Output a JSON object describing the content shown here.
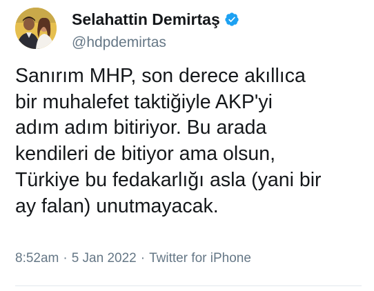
{
  "user": {
    "display_name": "Selahattin Demirtaş",
    "handle": "@hdpdemirtas",
    "verified_icon": "verified-badge-icon",
    "avatar_icon": "profile-photo"
  },
  "tweet": {
    "line_1": "Sanırım MHP, son derece akıllıca",
    "line_2": "bir muhalefet taktiğiyle AKP'yi",
    "line_3": "adım adım bitiriyor. Bu arada",
    "line_4": "kendileri de bitiyor ama olsun,",
    "line_5": "Türkiye bu fedakarlığı asla (yani bir",
    "line_6": "ay falan) unutmayacak."
  },
  "meta": {
    "time": "8:52am",
    "separator": "·",
    "date": "5 Jan 2022",
    "source": "Twitter for iPhone"
  },
  "colors": {
    "text": "#14171a",
    "secondary": "#657786",
    "verified": "#1da1f2",
    "divider": "#e1e8ed"
  }
}
